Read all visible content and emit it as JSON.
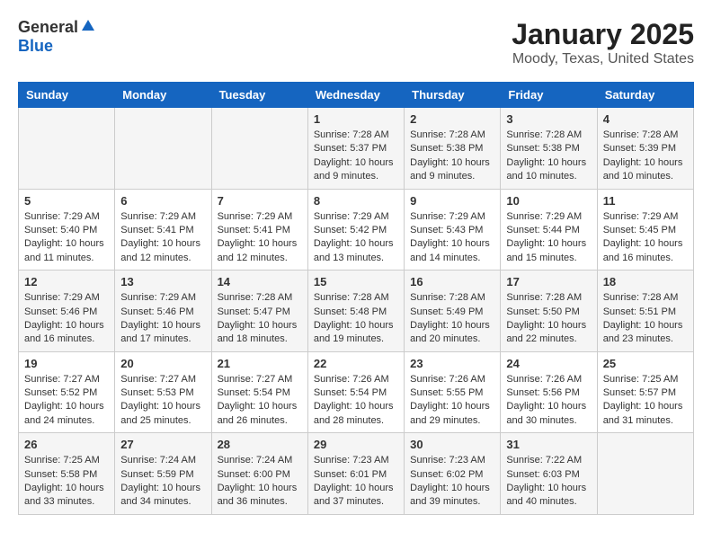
{
  "header": {
    "logo_general": "General",
    "logo_blue": "Blue",
    "title": "January 2025",
    "subtitle": "Moody, Texas, United States"
  },
  "weekdays": [
    "Sunday",
    "Monday",
    "Tuesday",
    "Wednesday",
    "Thursday",
    "Friday",
    "Saturday"
  ],
  "weeks": [
    [
      {
        "day": "",
        "info": ""
      },
      {
        "day": "",
        "info": ""
      },
      {
        "day": "",
        "info": ""
      },
      {
        "day": "1",
        "info": "Sunrise: 7:28 AM\nSunset: 5:37 PM\nDaylight: 10 hours and 9 minutes."
      },
      {
        "day": "2",
        "info": "Sunrise: 7:28 AM\nSunset: 5:38 PM\nDaylight: 10 hours and 9 minutes."
      },
      {
        "day": "3",
        "info": "Sunrise: 7:28 AM\nSunset: 5:38 PM\nDaylight: 10 hours and 10 minutes."
      },
      {
        "day": "4",
        "info": "Sunrise: 7:28 AM\nSunset: 5:39 PM\nDaylight: 10 hours and 10 minutes."
      }
    ],
    [
      {
        "day": "5",
        "info": "Sunrise: 7:29 AM\nSunset: 5:40 PM\nDaylight: 10 hours and 11 minutes."
      },
      {
        "day": "6",
        "info": "Sunrise: 7:29 AM\nSunset: 5:41 PM\nDaylight: 10 hours and 12 minutes."
      },
      {
        "day": "7",
        "info": "Sunrise: 7:29 AM\nSunset: 5:41 PM\nDaylight: 10 hours and 12 minutes."
      },
      {
        "day": "8",
        "info": "Sunrise: 7:29 AM\nSunset: 5:42 PM\nDaylight: 10 hours and 13 minutes."
      },
      {
        "day": "9",
        "info": "Sunrise: 7:29 AM\nSunset: 5:43 PM\nDaylight: 10 hours and 14 minutes."
      },
      {
        "day": "10",
        "info": "Sunrise: 7:29 AM\nSunset: 5:44 PM\nDaylight: 10 hours and 15 minutes."
      },
      {
        "day": "11",
        "info": "Sunrise: 7:29 AM\nSunset: 5:45 PM\nDaylight: 10 hours and 16 minutes."
      }
    ],
    [
      {
        "day": "12",
        "info": "Sunrise: 7:29 AM\nSunset: 5:46 PM\nDaylight: 10 hours and 16 minutes."
      },
      {
        "day": "13",
        "info": "Sunrise: 7:29 AM\nSunset: 5:46 PM\nDaylight: 10 hours and 17 minutes."
      },
      {
        "day": "14",
        "info": "Sunrise: 7:28 AM\nSunset: 5:47 PM\nDaylight: 10 hours and 18 minutes."
      },
      {
        "day": "15",
        "info": "Sunrise: 7:28 AM\nSunset: 5:48 PM\nDaylight: 10 hours and 19 minutes."
      },
      {
        "day": "16",
        "info": "Sunrise: 7:28 AM\nSunset: 5:49 PM\nDaylight: 10 hours and 20 minutes."
      },
      {
        "day": "17",
        "info": "Sunrise: 7:28 AM\nSunset: 5:50 PM\nDaylight: 10 hours and 22 minutes."
      },
      {
        "day": "18",
        "info": "Sunrise: 7:28 AM\nSunset: 5:51 PM\nDaylight: 10 hours and 23 minutes."
      }
    ],
    [
      {
        "day": "19",
        "info": "Sunrise: 7:27 AM\nSunset: 5:52 PM\nDaylight: 10 hours and 24 minutes."
      },
      {
        "day": "20",
        "info": "Sunrise: 7:27 AM\nSunset: 5:53 PM\nDaylight: 10 hours and 25 minutes."
      },
      {
        "day": "21",
        "info": "Sunrise: 7:27 AM\nSunset: 5:54 PM\nDaylight: 10 hours and 26 minutes."
      },
      {
        "day": "22",
        "info": "Sunrise: 7:26 AM\nSunset: 5:54 PM\nDaylight: 10 hours and 28 minutes."
      },
      {
        "day": "23",
        "info": "Sunrise: 7:26 AM\nSunset: 5:55 PM\nDaylight: 10 hours and 29 minutes."
      },
      {
        "day": "24",
        "info": "Sunrise: 7:26 AM\nSunset: 5:56 PM\nDaylight: 10 hours and 30 minutes."
      },
      {
        "day": "25",
        "info": "Sunrise: 7:25 AM\nSunset: 5:57 PM\nDaylight: 10 hours and 31 minutes."
      }
    ],
    [
      {
        "day": "26",
        "info": "Sunrise: 7:25 AM\nSunset: 5:58 PM\nDaylight: 10 hours and 33 minutes."
      },
      {
        "day": "27",
        "info": "Sunrise: 7:24 AM\nSunset: 5:59 PM\nDaylight: 10 hours and 34 minutes."
      },
      {
        "day": "28",
        "info": "Sunrise: 7:24 AM\nSunset: 6:00 PM\nDaylight: 10 hours and 36 minutes."
      },
      {
        "day": "29",
        "info": "Sunrise: 7:23 AM\nSunset: 6:01 PM\nDaylight: 10 hours and 37 minutes."
      },
      {
        "day": "30",
        "info": "Sunrise: 7:23 AM\nSunset: 6:02 PM\nDaylight: 10 hours and 39 minutes."
      },
      {
        "day": "31",
        "info": "Sunrise: 7:22 AM\nSunset: 6:03 PM\nDaylight: 10 hours and 40 minutes."
      },
      {
        "day": "",
        "info": ""
      }
    ]
  ]
}
